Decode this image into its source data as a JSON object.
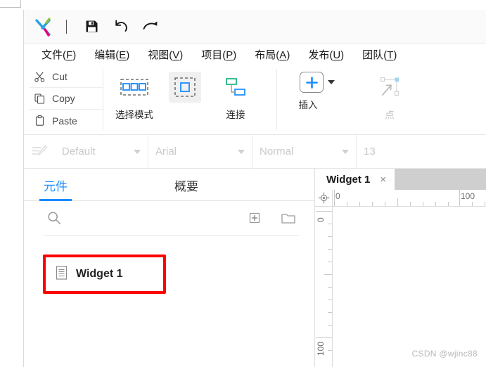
{
  "app": {
    "logo": "axure-x-logo",
    "quick_access": [
      {
        "name": "save-icon",
        "label": "Save"
      },
      {
        "name": "undo-icon",
        "label": "Undo"
      },
      {
        "name": "redo-icon",
        "label": "Redo"
      }
    ]
  },
  "menubar": {
    "items": [
      {
        "label": "文件",
        "accel": "F"
      },
      {
        "label": "编辑",
        "accel": "E"
      },
      {
        "label": "视图",
        "accel": "V"
      },
      {
        "label": "项目",
        "accel": "P"
      },
      {
        "label": "布局",
        "accel": "A"
      },
      {
        "label": "发布",
        "accel": "U"
      },
      {
        "label": "团队",
        "accel": "T"
      }
    ]
  },
  "ribbon": {
    "clipboard": [
      {
        "label": "Cut",
        "icon": "scissors-icon"
      },
      {
        "label": "Copy",
        "icon": "copy-icon"
      },
      {
        "label": "Paste",
        "icon": "clipboard-icon"
      }
    ],
    "tools": [
      {
        "label": "选择模式",
        "icon": "select-mode-contained-icon",
        "selected": false,
        "disabled": false
      },
      {
        "label": "",
        "icon": "select-mode-touching-icon",
        "selected": true,
        "disabled": false
      },
      {
        "label": "连接",
        "icon": "connect-icon",
        "selected": false,
        "disabled": false
      }
    ],
    "insert": {
      "label": "插入",
      "icon": "plus-icon",
      "has_dropdown": true
    },
    "point": {
      "label": "点",
      "icon": "point-tool-icon",
      "disabled": true
    }
  },
  "formatbar": {
    "style_icon": "text-style-icon",
    "style": "Default",
    "font": "Arial",
    "weight": "Normal",
    "size": "13",
    "disabled": true
  },
  "left_panel": {
    "tabs": [
      {
        "label": "元件",
        "active": true
      },
      {
        "label": "概要",
        "active": false
      }
    ],
    "toolbar": [
      {
        "name": "search-icon"
      },
      {
        "name": "add-page-icon"
      },
      {
        "name": "new-folder-icon"
      }
    ],
    "items": [
      {
        "label": "Widget 1",
        "icon": "page-icon",
        "highlighted": true
      }
    ]
  },
  "canvas": {
    "tab": {
      "label": "Widget 1",
      "close": "×"
    },
    "ruler_corner_icon": "crosshair-icon",
    "h_ruler": {
      "labels": [
        "0",
        "100"
      ],
      "positions": [
        4,
        182
      ]
    },
    "v_ruler": {
      "labels": [
        "0",
        "100"
      ],
      "positions": [
        6,
        184
      ]
    }
  },
  "watermark": "CSDN @wjinc88",
  "colors": {
    "accent": "#1a8cff",
    "highlight": "#ff0000",
    "logo_blue": "#29a3e0",
    "logo_green": "#8cc63f",
    "logo_pink": "#e6007e",
    "tabstrip_bg": "#cfcfcf"
  }
}
